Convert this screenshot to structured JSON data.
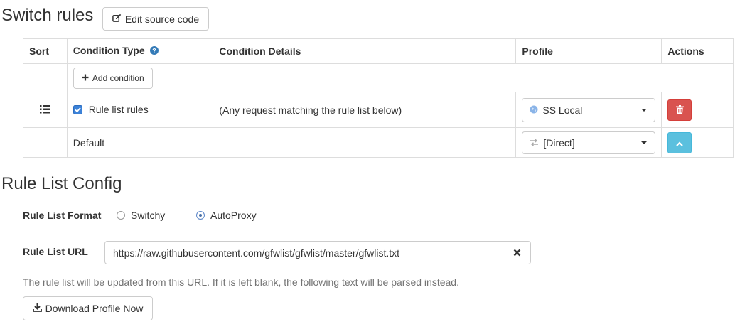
{
  "switch_rules": {
    "title": "Switch rules",
    "edit_source_label": "Edit source code"
  },
  "table": {
    "headers": {
      "sort": "Sort",
      "condition_type": "Condition Type",
      "condition_details": "Condition Details",
      "profile": "Profile",
      "actions": "Actions"
    },
    "add_condition_label": "Add condition",
    "rule_row": {
      "checked": true,
      "condition_type": "Rule list rules",
      "condition_details": "(Any request matching the rule list below)",
      "profile": "SS Local",
      "profile_icon": "globe-icon",
      "action_icon": "trash-icon"
    },
    "default_row": {
      "label": "Default",
      "profile": "[Direct]",
      "profile_icon": "exchange-icon",
      "action_icon": "chevron-up-icon"
    }
  },
  "rule_list_config": {
    "title": "Rule List Config",
    "format_label": "Rule List Format",
    "format_options": [
      "Switchy",
      "AutoProxy"
    ],
    "selected_format": "AutoProxy",
    "url_label": "Rule List URL",
    "url_value": "https://raw.githubusercontent.com/gfwlist/gfwlist/master/gfwlist.txt",
    "help_text": "The rule list will be updated from this URL. If it is left blank, the following text will be parsed instead.",
    "download_label": "Download Profile Now"
  },
  "colors": {
    "danger": "#d9534f",
    "info": "#5bc0de",
    "help_icon": "#337ab7",
    "muted_text": "#737373"
  }
}
